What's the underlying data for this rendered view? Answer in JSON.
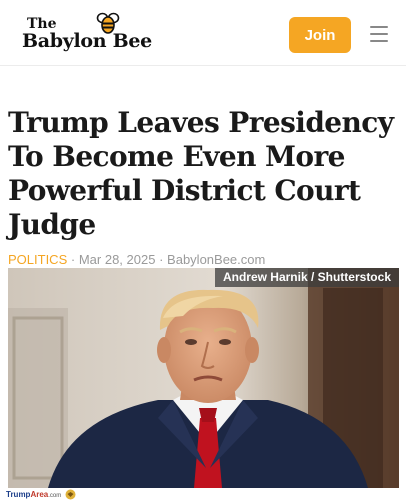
{
  "header": {
    "logo_top": "The",
    "logo_name": "Babylon Bee",
    "join_label": "Join"
  },
  "article": {
    "headline": "Trump Leaves Presidency To Become Even More Powerful District Court Judge",
    "category": "POLITICS",
    "separator": "·",
    "date": "Mar 28, 2025",
    "source": "BabylonBee.com",
    "photo_credit": "Andrew Harnik / Shutterstock"
  },
  "watermark": {
    "part1": "Trump",
    "part2": "Area",
    "suffix": ".com"
  },
  "colors": {
    "accent": "#f5a623",
    "headline": "#1a1a1a",
    "meta": "#9a9a9a"
  },
  "icons": [
    "bee-icon",
    "menu-icon",
    "eagle-icon"
  ]
}
